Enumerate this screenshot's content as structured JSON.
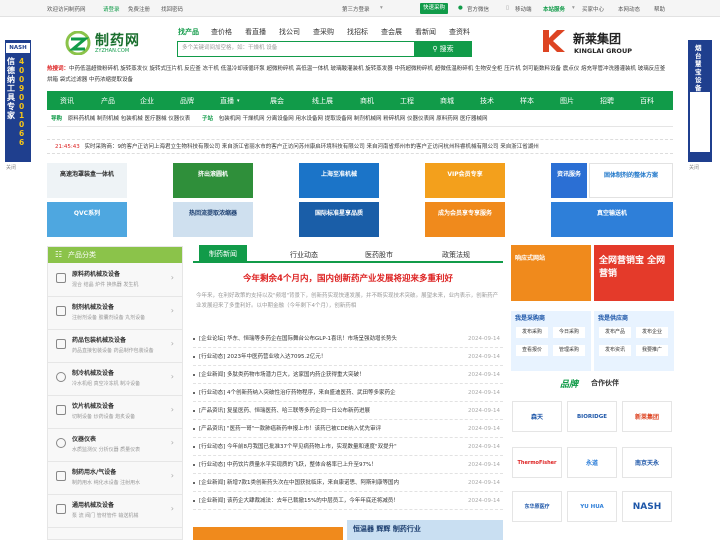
{
  "topbar": {
    "welcome": "欢迎访问制药网",
    "login": "请登录",
    "register": "免费注册",
    "findpwd": "找回密码",
    "third_login": "第三方登录",
    "quick_buy": "快速采购",
    "wechat": "官方微信",
    "mobile": "移动端",
    "service": "本站服务",
    "buyer_center": "买家中心",
    "contact": "本网动态",
    "help": "帮助"
  },
  "logo": {
    "name": "制药网",
    "sub": "ZYZHAN.COM"
  },
  "search": {
    "tabs": [
      "找产品",
      "查价格",
      "看直播",
      "找公司",
      "查采购",
      "找招标",
      "查会展",
      "看新闻",
      "查资料"
    ],
    "placeholder": "多个关键词间加空格，如：干燥机 设备",
    "button": "搜索"
  },
  "brand_ad": {
    "name": "新莱集团",
    "en": "KINGLAI GROUP"
  },
  "hotwords": {
    "label": "热搜词：",
    "text": "中药低温超微粉碎机 旋转蒸发仪 旋转式压片机 反应釜 冻干机 低温冷却液循环泵 超微粉碎机 高低温一体机 玻璃酸灌装机 旋转蒸发器 中药超微粉碎机 超微低温粉碎机 生物安全柜 压片机 剑可能数料设备 震点仪 熔充导管冲洗器灌装机 玻璃反应釜 烘箱 袋式过滤器 中药浓缩提取设备"
  },
  "nav": [
    "资讯",
    "产品",
    "企业",
    "品牌",
    "直播",
    "展会",
    "线上展",
    "商机",
    "工程",
    "商城",
    "技术",
    "样本",
    "图片",
    "招聘",
    "百科"
  ],
  "subnav": {
    "g1": "导购",
    "g1_items": "原料药机械 制剂机械 包装机械 医疗器械 仪器仪表",
    "g2": "子站",
    "g2_items": "包装机网 干燥机网 分离设备网 用水设备网 提取设备网 制剂机械网 粉碎机网 仪器仪表网 原料药网 医疗器械网"
  },
  "ticker": {
    "time": "21:45:43",
    "text": "实时采购商：9的客户正访问上海君立生物科技有限公司 来自浙江省丽水市的客户正访问苏州康启环境科技有限公司 来自河南省郑州市的客户正访问杭州科睿机械有限公司 来自浙江省湖州"
  },
  "banners": [
    "高速泡罩装盒一体机",
    "挤出滚圆机",
    "上海至准机械",
    "VIP会员专享",
    "资讯服务",
    "固体制剂的整体方案",
    "QVC系列",
    "热回流提取浓缩器",
    "国际标准星享品质",
    "成为会员享专享服务",
    "真空输送机"
  ],
  "category": {
    "title": "产品分类",
    "items": [
      {
        "t": "原料药机械及设备",
        "s": "混合 结晶 炉件 换热器 发生机"
      },
      {
        "t": "制剂机械及设备",
        "s": "注射剂设备 胶囊剂设备 丸剂设备"
      },
      {
        "t": "药品包装机械及设备",
        "s": "药品直接包装设备 药品制作包装设备"
      },
      {
        "t": "制冷机械及设备",
        "s": "冷水机组 真空冷冻机 制冷设备"
      },
      {
        "t": "饮片机械及设备",
        "s": "切制设备 炒药设备 炮炙设备"
      },
      {
        "t": "仪器仪表",
        "s": "水质监测仪 分析仪器 质量仪表"
      },
      {
        "t": "制药用水/气设备",
        "s": "制药用水 纯化水设备 注射用水"
      },
      {
        "t": "通用机械及设备",
        "s": "泵 流 阀门 管材管件 输送机械"
      }
    ]
  },
  "news": {
    "tabs": [
      "制药新闻",
      "行业动态",
      "医药股市",
      "政策法规"
    ],
    "headline": "今年剩余4个月内，国内创新药产业发展将迎来多重利好",
    "summary": "今年来，在利好政策的支持以及\"频增\"背景下，创新药实现快速发展，并不断实现技术突破。展望未来，业内表示，创新药产业发展迎来了多重利好。以中期金融（今年剩下4个月），创新药相",
    "items": [
      {
        "t": "[企业论坛] 华东、恒瑞等多药企在国际舞台公布GLP-1喜讯！市场呈强劲增长势头",
        "d": "2024-09-14"
      },
      {
        "t": "[行业动态] 2023年中医药营业收入达7095.2亿元！",
        "d": "2024-09-14"
      },
      {
        "t": "[企业新闻] 多肽类药物市场潜力巨大，这家国内药企获得重大突破！",
        "d": "2024-09-14"
      },
      {
        "t": "[行业动态] 4个创新药纳入突破性治疗药物程序，来自盛迪医药、武田等多家药企",
        "d": "2024-09-14"
      },
      {
        "t": "[产品资讯] 复星医药、恒瑞医药、哈三联等多药企同一日公布新药进展",
        "d": "2024-09-14"
      },
      {
        "t": "[产品资讯] \"医药一哥\"一款肺癌新药申报上市！该药已被CDE纳入优先审评",
        "d": "2024-09-14"
      },
      {
        "t": "[行业动态] 今年前8月我国已批准37个罕见病药物上市，实现数量和速度\"双提升\"",
        "d": "2024-09-14"
      },
      {
        "t": "[行业动态] 中药饮片质量水平实现质的飞跃，整体合格率已上升至97%！",
        "d": "2024-09-14"
      },
      {
        "t": "[企业新闻] 新增7款1类创新药头次在中国获批临床，来自康诺思、阿斯利康等国内",
        "d": "2024-09-14"
      },
      {
        "t": "[企业新闻] 该药企大肆裁减法：去年已裁撤15%的中层员工，今年年底还将减员！",
        "d": "2024-09-14"
      }
    ]
  },
  "right": {
    "ad1": "响应式网站",
    "ad2": "全网营销宝 全网营销",
    "buy_title": "我是采购商",
    "buy_items": [
      "发布采购",
      "今日采购",
      "查看报价",
      "管理采购"
    ],
    "sell_title": "我是供应商",
    "sell_items": [
      "发布产品",
      "发布企业",
      "发布资讯",
      "我要推广"
    ],
    "brand_title": "品牌",
    "brand_title2": "合作伙伴",
    "brands": [
      "森天",
      "BIORIDGE",
      "新莱集团",
      "ThermoFisher",
      "永道",
      "南京天永",
      "东华原医疗",
      "YU HUA",
      "NASH"
    ],
    "vip_banner": "恒温器 辉辉 制药行业"
  },
  "side": {
    "left_text": "信德纳工具专家",
    "left_phone": "4009001066",
    "left_close": "关闭",
    "right_text": "烟台慧宝设备",
    "right_close": "关闭"
  }
}
